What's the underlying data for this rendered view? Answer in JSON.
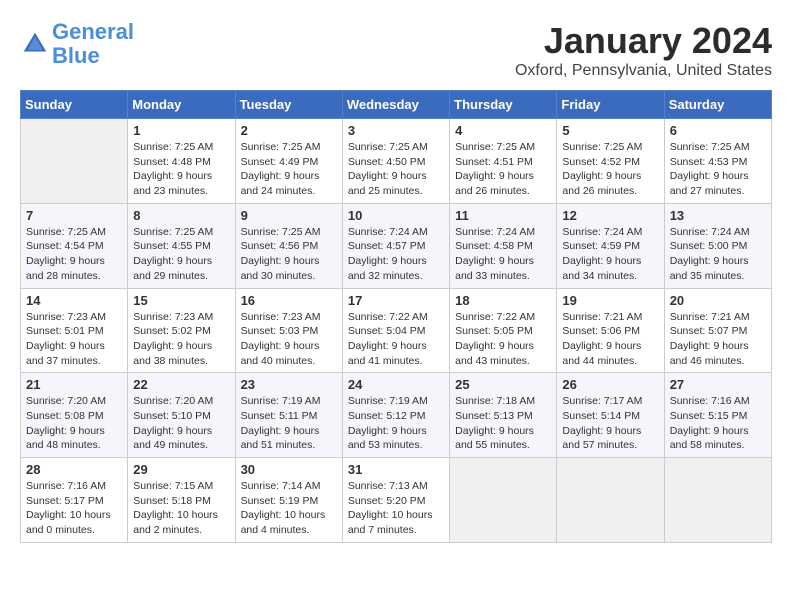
{
  "header": {
    "logo_line1": "General",
    "logo_line2": "Blue",
    "month": "January 2024",
    "location": "Oxford, Pennsylvania, United States"
  },
  "weekdays": [
    "Sunday",
    "Monday",
    "Tuesday",
    "Wednesday",
    "Thursday",
    "Friday",
    "Saturday"
  ],
  "weeks": [
    [
      {
        "day": null
      },
      {
        "day": 1,
        "sunrise": "7:25 AM",
        "sunset": "4:48 PM",
        "daylight": "9 hours and 23 minutes."
      },
      {
        "day": 2,
        "sunrise": "7:25 AM",
        "sunset": "4:49 PM",
        "daylight": "9 hours and 24 minutes."
      },
      {
        "day": 3,
        "sunrise": "7:25 AM",
        "sunset": "4:50 PM",
        "daylight": "9 hours and 25 minutes."
      },
      {
        "day": 4,
        "sunrise": "7:25 AM",
        "sunset": "4:51 PM",
        "daylight": "9 hours and 26 minutes."
      },
      {
        "day": 5,
        "sunrise": "7:25 AM",
        "sunset": "4:52 PM",
        "daylight": "9 hours and 26 minutes."
      },
      {
        "day": 6,
        "sunrise": "7:25 AM",
        "sunset": "4:53 PM",
        "daylight": "9 hours and 27 minutes."
      }
    ],
    [
      {
        "day": 7,
        "sunrise": "7:25 AM",
        "sunset": "4:54 PM",
        "daylight": "9 hours and 28 minutes."
      },
      {
        "day": 8,
        "sunrise": "7:25 AM",
        "sunset": "4:55 PM",
        "daylight": "9 hours and 29 minutes."
      },
      {
        "day": 9,
        "sunrise": "7:25 AM",
        "sunset": "4:56 PM",
        "daylight": "9 hours and 30 minutes."
      },
      {
        "day": 10,
        "sunrise": "7:24 AM",
        "sunset": "4:57 PM",
        "daylight": "9 hours and 32 minutes."
      },
      {
        "day": 11,
        "sunrise": "7:24 AM",
        "sunset": "4:58 PM",
        "daylight": "9 hours and 33 minutes."
      },
      {
        "day": 12,
        "sunrise": "7:24 AM",
        "sunset": "4:59 PM",
        "daylight": "9 hours and 34 minutes."
      },
      {
        "day": 13,
        "sunrise": "7:24 AM",
        "sunset": "5:00 PM",
        "daylight": "9 hours and 35 minutes."
      }
    ],
    [
      {
        "day": 14,
        "sunrise": "7:23 AM",
        "sunset": "5:01 PM",
        "daylight": "9 hours and 37 minutes."
      },
      {
        "day": 15,
        "sunrise": "7:23 AM",
        "sunset": "5:02 PM",
        "daylight": "9 hours and 38 minutes."
      },
      {
        "day": 16,
        "sunrise": "7:23 AM",
        "sunset": "5:03 PM",
        "daylight": "9 hours and 40 minutes."
      },
      {
        "day": 17,
        "sunrise": "7:22 AM",
        "sunset": "5:04 PM",
        "daylight": "9 hours and 41 minutes."
      },
      {
        "day": 18,
        "sunrise": "7:22 AM",
        "sunset": "5:05 PM",
        "daylight": "9 hours and 43 minutes."
      },
      {
        "day": 19,
        "sunrise": "7:21 AM",
        "sunset": "5:06 PM",
        "daylight": "9 hours and 44 minutes."
      },
      {
        "day": 20,
        "sunrise": "7:21 AM",
        "sunset": "5:07 PM",
        "daylight": "9 hours and 46 minutes."
      }
    ],
    [
      {
        "day": 21,
        "sunrise": "7:20 AM",
        "sunset": "5:08 PM",
        "daylight": "9 hours and 48 minutes."
      },
      {
        "day": 22,
        "sunrise": "7:20 AM",
        "sunset": "5:10 PM",
        "daylight": "9 hours and 49 minutes."
      },
      {
        "day": 23,
        "sunrise": "7:19 AM",
        "sunset": "5:11 PM",
        "daylight": "9 hours and 51 minutes."
      },
      {
        "day": 24,
        "sunrise": "7:19 AM",
        "sunset": "5:12 PM",
        "daylight": "9 hours and 53 minutes."
      },
      {
        "day": 25,
        "sunrise": "7:18 AM",
        "sunset": "5:13 PM",
        "daylight": "9 hours and 55 minutes."
      },
      {
        "day": 26,
        "sunrise": "7:17 AM",
        "sunset": "5:14 PM",
        "daylight": "9 hours and 57 minutes."
      },
      {
        "day": 27,
        "sunrise": "7:16 AM",
        "sunset": "5:15 PM",
        "daylight": "9 hours and 58 minutes."
      }
    ],
    [
      {
        "day": 28,
        "sunrise": "7:16 AM",
        "sunset": "5:17 PM",
        "daylight": "10 hours and 0 minutes."
      },
      {
        "day": 29,
        "sunrise": "7:15 AM",
        "sunset": "5:18 PM",
        "daylight": "10 hours and 2 minutes."
      },
      {
        "day": 30,
        "sunrise": "7:14 AM",
        "sunset": "5:19 PM",
        "daylight": "10 hours and 4 minutes."
      },
      {
        "day": 31,
        "sunrise": "7:13 AM",
        "sunset": "5:20 PM",
        "daylight": "10 hours and 7 minutes."
      },
      {
        "day": null
      },
      {
        "day": null
      },
      {
        "day": null
      }
    ]
  ]
}
